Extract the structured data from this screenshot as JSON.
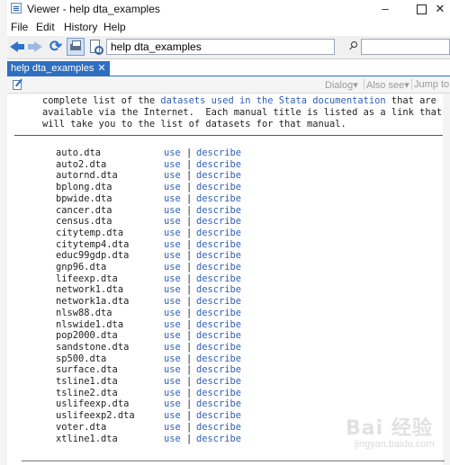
{
  "window": {
    "title": "Viewer - help dta_examples"
  },
  "window_controls": {
    "minimize": "–",
    "close": "✕"
  },
  "menu": {
    "items": [
      "File",
      "Edit",
      "History",
      "Help"
    ]
  },
  "toolbar": {
    "command_value": "help dta_examples",
    "refresh_glyph": "⟳"
  },
  "tab": {
    "label": "help dta_examples",
    "close": "✕"
  },
  "secondary": {
    "dialog_label": "Dialog",
    "also_see_label": "Also see",
    "jump_label": "Jump to",
    "dropdown_glyph": "▾"
  },
  "intro": {
    "line1_a": "complete list of the ",
    "line1_link": "datasets used in the Stata documentation",
    "line1_b": " that are",
    "line2": "available via the Internet.  Each manual title is listed as a link that",
    "line3": "will take you to the list of datasets for that manual."
  },
  "list": {
    "use_label": "use",
    "separator": "|",
    "describe_label": "describe",
    "files": [
      "auto.dta",
      "auto2.dta",
      "autornd.dta",
      "bplong.dta",
      "bpwide.dta",
      "cancer.dta",
      "census.dta",
      "citytemp.dta",
      "citytemp4.dta",
      "educ99gdp.dta",
      "gnp96.dta",
      "lifeexp.dta",
      "network1.dta",
      "network1a.dta",
      "nlsw88.dta",
      "nlswide1.dta",
      "pop2000.dta",
      "sandstone.dta",
      "sp500.dta",
      "surface.dta",
      "tsline1.dta",
      "tsline2.dta",
      "uslifeexp.dta",
      "uslifeexp2.dta",
      "voter.dta",
      "xtline1.dta"
    ]
  },
  "watermark": {
    "text": "Bai 经验",
    "url": "jingyan.baidu.com"
  }
}
